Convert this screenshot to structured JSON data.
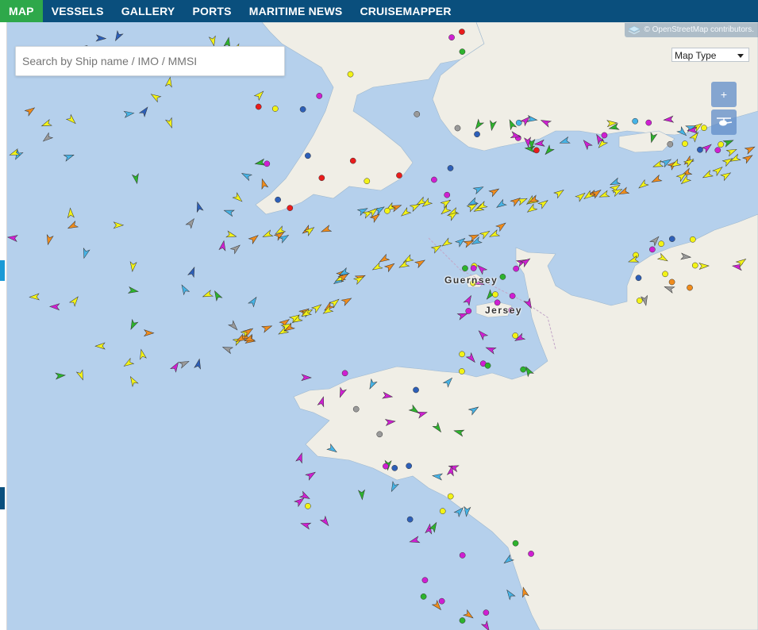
{
  "nav": {
    "tabs": [
      {
        "label": "MAP",
        "active": true
      },
      {
        "label": "VESSELS",
        "active": false
      },
      {
        "label": "GALLERY",
        "active": false
      },
      {
        "label": "PORTS",
        "active": false
      },
      {
        "label": "MARITIME NEWS",
        "active": false
      },
      {
        "label": "CRUISEMAPPER",
        "active": false
      }
    ],
    "background": "#0a4f7d",
    "active_color": "#2ea84a"
  },
  "search": {
    "placeholder": "Search by Ship name / IMO / MMSI",
    "value": ""
  },
  "map": {
    "attribution": "© OpenStreetMap contributors.",
    "map_type_label": "Map Type",
    "zoom_in_label": "+",
    "layer_icon": "helicopter-layer-icon",
    "places": [
      {
        "name": "Guernsey"
      },
      {
        "name": "Jersey"
      }
    ],
    "colors": {
      "sea": "#b5d0ec",
      "land": "#f0eee6",
      "border": "#c3a7c8"
    },
    "vessel_colors": {
      "cargo": "#f3f316",
      "passenger": "#cf1fd2",
      "tanker": "#f08c1c",
      "fishing": "#46b3e6",
      "tug": "#2db32d",
      "unknown": "#9a9a9a",
      "high_speed": "#e91c1c",
      "other": "#2d5fb8"
    }
  }
}
